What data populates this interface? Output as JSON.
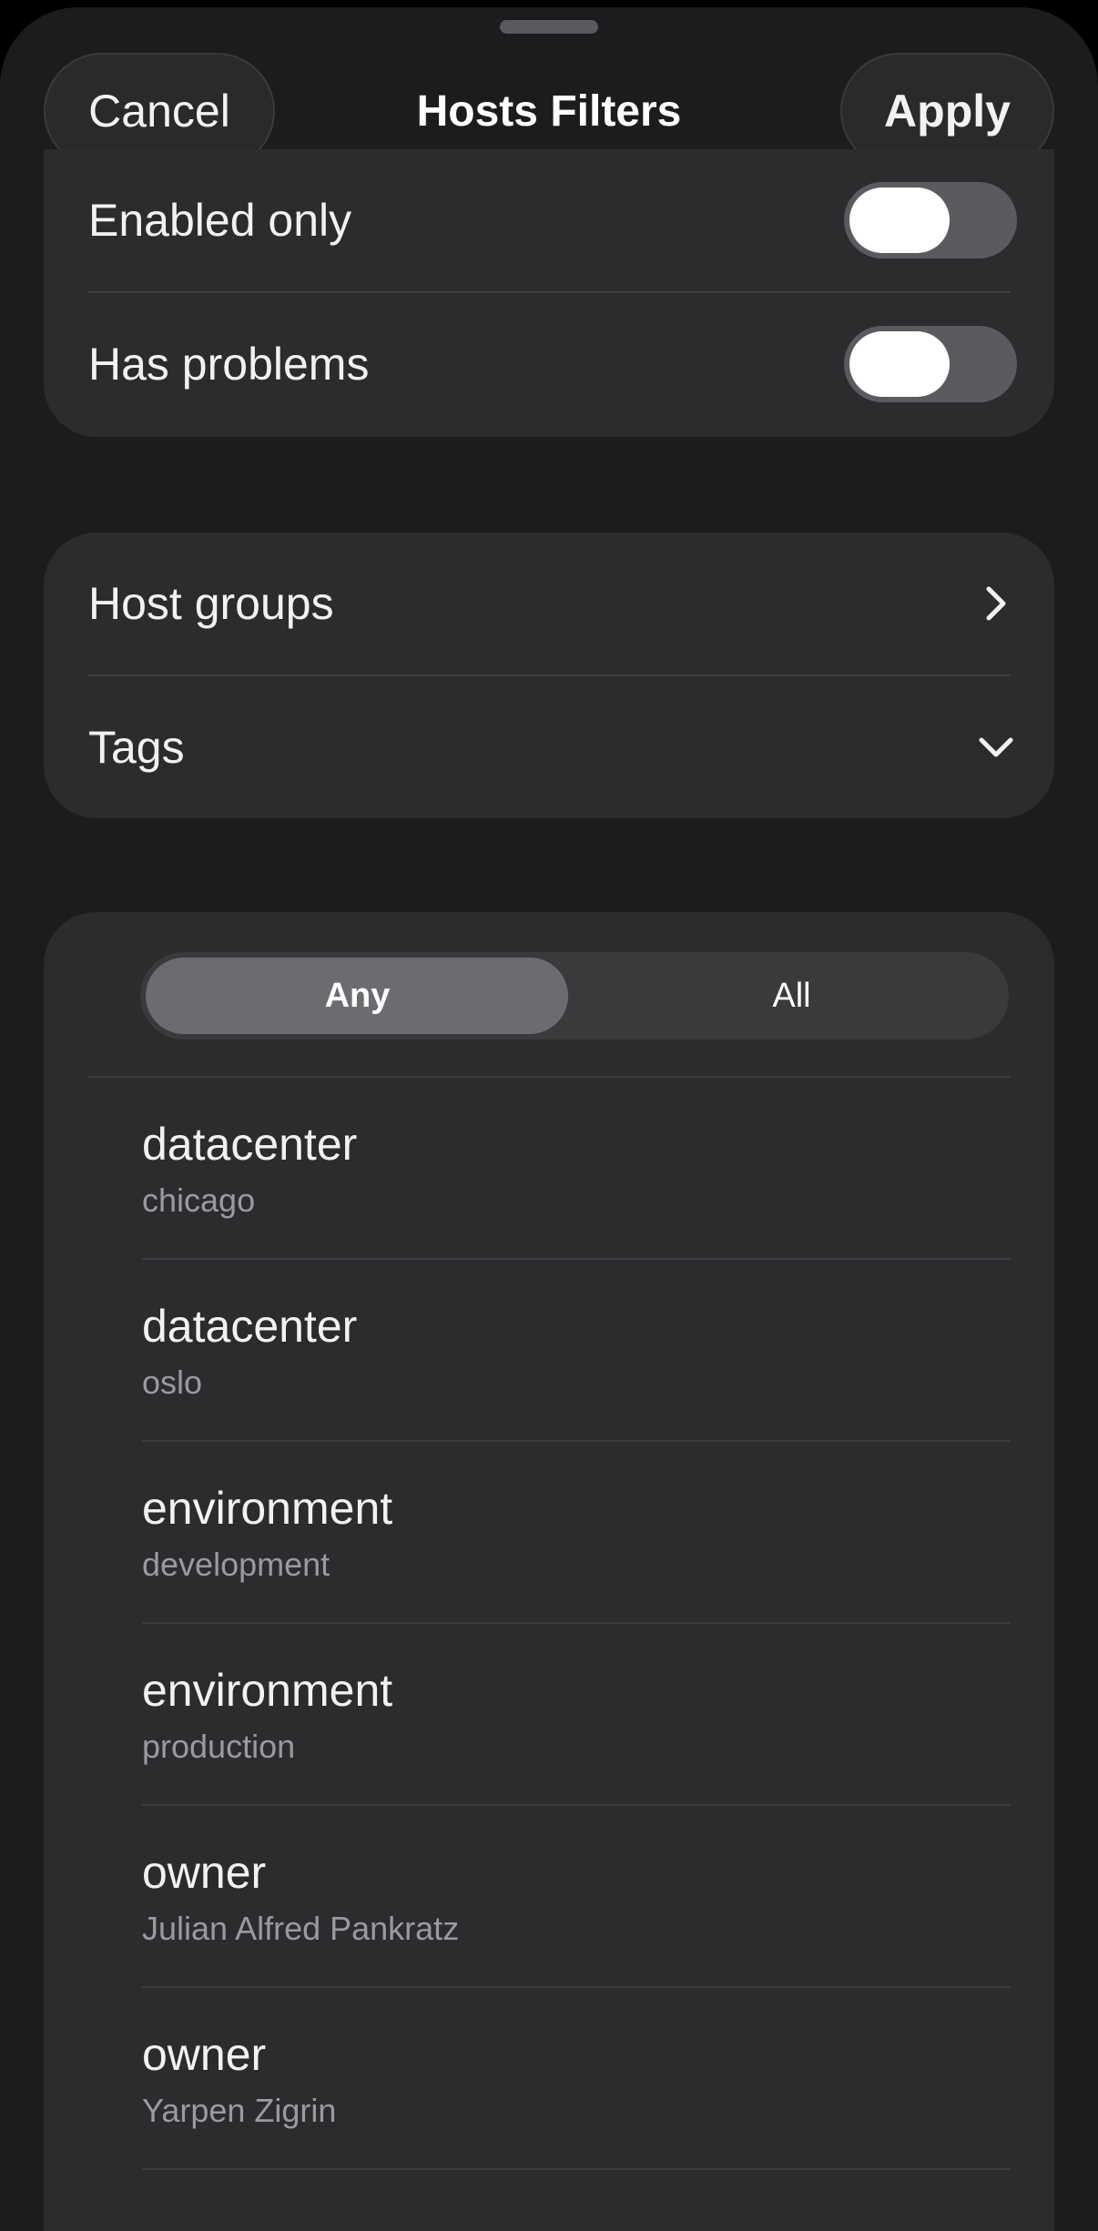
{
  "nav": {
    "title": "Hosts Filters",
    "cancel_label": "Cancel",
    "apply_label": "Apply"
  },
  "toggles": [
    {
      "label": "Enabled only",
      "on": false
    },
    {
      "label": "Has problems",
      "on": false
    }
  ],
  "groups": [
    {
      "label": "Host groups",
      "icon": "chevron-right-icon"
    },
    {
      "label": "Tags",
      "icon": "chevron-down-icon"
    }
  ],
  "match_mode": {
    "options": [
      "Any",
      "All"
    ],
    "selected": "Any"
  },
  "tags": [
    {
      "key": "datacenter",
      "value": "chicago"
    },
    {
      "key": "datacenter",
      "value": "oslo"
    },
    {
      "key": "environment",
      "value": "development"
    },
    {
      "key": "environment",
      "value": "production"
    },
    {
      "key": "owner",
      "value": "Julian Alfred Pankratz"
    },
    {
      "key": "owner",
      "value": "Yarpen Zigrin"
    }
  ],
  "colors": {
    "sheet_background": "#1c1c1e",
    "group_background": "#2c2c2e",
    "toggle_track_off": "#5b5b5f",
    "segment_selected": "#6c6c70",
    "secondary_text": "#9a9a9f"
  }
}
